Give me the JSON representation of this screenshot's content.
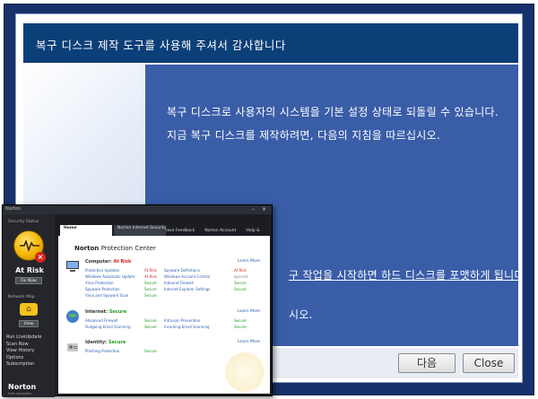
{
  "dialog": {
    "title": "복구 디스크 제작 도구를 사용해 주셔서 감사합니다",
    "lines": [
      "복구 디스크로 사용자의 시스템을 기본 설정 상태로 되돌릴 수 있습니다.",
      "지금 복구 디스크를 제작하려면, 다음의 지침을 따르십시오.",
      "구 작업을 시작하면 하드 디스크를 포맷하게 됩니다.",
      "시오."
    ],
    "next_label": "다음",
    "close_label": "Close"
  },
  "norton": {
    "window_title": "Norton",
    "min_glyph": "–",
    "close_glyph": "×",
    "security_status_label": "Security Status",
    "status": "At Risk",
    "fix_now": "Fix Now",
    "network_map_label": "Network Map",
    "view_label": "View",
    "side_links": [
      "Run LiveUpdate",
      "Scan Now",
      "View History",
      "Options",
      "Subscription"
    ],
    "logo": "Norton",
    "logo_sub": "from symantec",
    "tabs": [
      "Home",
      "Norton Internet Security"
    ],
    "top_links": [
      "Leave Feedback",
      "Norton Account",
      "Help & Support"
    ],
    "center_title": "Norton",
    "center_title_sub": "Protection Center",
    "sections": [
      {
        "heading": "Computer:",
        "status": "At Risk",
        "status_color": "#d8241e",
        "learn_more": "Learn More",
        "rows": [
          [
            "Protection Updates",
            "At Risk",
            "Spyware Definitions",
            "At Risk"
          ],
          [
            "Windows Automatic Update",
            "At Risk",
            "Windows Account Control",
            "Ignored"
          ],
          [
            "Virus Protection",
            "Secure",
            "Inbound Firewall",
            "Secure"
          ],
          [
            "Spyware Protection",
            "Secure",
            "Internet Explorer Settings",
            "Secure"
          ],
          [
            "Virus and Spyware Scan",
            "Secure",
            "",
            ""
          ]
        ]
      },
      {
        "heading": "Internet:",
        "status": "Secure",
        "status_color": "#1f9a1f",
        "learn_more": "Learn More",
        "rows": [
          [
            "Advanced Firewall",
            "Secure",
            "Intrusion Prevention",
            "Secure"
          ],
          [
            "Outgoing Email Scanning",
            "Secure",
            "Incoming Email Scanning",
            "Secure"
          ]
        ]
      },
      {
        "heading": "Identity:",
        "status": "Secure",
        "status_color": "#1f9a1f",
        "learn_more": "Learn More",
        "rows": [
          [
            "Phishing Protection",
            "Secure",
            "",
            ""
          ]
        ]
      }
    ]
  }
}
